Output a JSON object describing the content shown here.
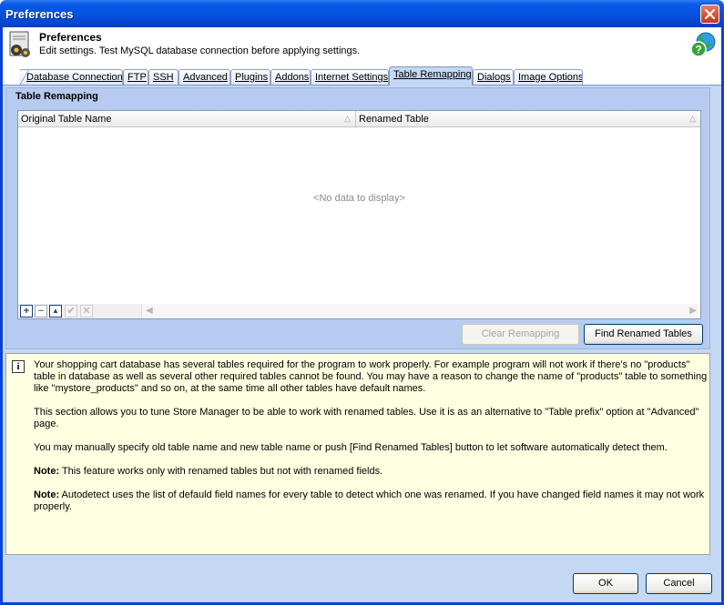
{
  "window": {
    "title": "Preferences",
    "close_icon": "close-icon"
  },
  "header": {
    "title": "Preferences",
    "subtitle": "Edit settings. Test MySQL database connection before applying settings.",
    "icon": "settings-gears-icon",
    "help_icon": "help-globe-icon"
  },
  "tabs": [
    {
      "label": "Database Connection",
      "active": false
    },
    {
      "label": "FTP",
      "active": false
    },
    {
      "label": "SSH",
      "active": false
    },
    {
      "label": "Advanced",
      "active": false
    },
    {
      "label": "Plugins",
      "active": false
    },
    {
      "label": "Addons",
      "active": false
    },
    {
      "label": "Internet Settings",
      "active": false
    },
    {
      "label": "Table Remapping",
      "active": true
    },
    {
      "label": "Dialogs",
      "active": false
    },
    {
      "label": "Image Options",
      "active": false
    }
  ],
  "group": {
    "title": "Table Remapping"
  },
  "grid": {
    "columns": [
      "Original Table Name",
      "Renamed Table"
    ],
    "rows": [],
    "empty_text": "<No data to display>",
    "navigator": {
      "add": "+",
      "remove": "−",
      "up": "▲",
      "accept": "✔",
      "cancel": "✕"
    },
    "scroll_left": "◀",
    "scroll_right": "▶"
  },
  "buttons": {
    "clear_remapping": "Clear Remapping",
    "find_renamed_tables": "Find Renamed Tables",
    "ok": "OK",
    "cancel": "Cancel"
  },
  "info": {
    "icon": "info-icon",
    "icon_glyph": "i",
    "p1": "Your shopping cart database has several tables required for the program to work properly. For example program will not work if there's no \"products\" table in database as well as several other required tables cannot be found. You may have a reason to change the name of \"products\" table to something like \"mystore_products\" and so on, at the same time all other tables have default names.",
    "p2": "This section allows you to tune Store Manager to be able to work with renamed tables. Use it is as an alternative to \"Table prefix\" option at \"Advanced\" page.",
    "p3": "You may manually specify old table name and new table name or push [Find Renamed Tables] button to let software automatically detect them.",
    "note1_label": "Note:",
    "note1_text": " This feature works only with renamed tables but not with renamed fields.",
    "note2_label": "Note:",
    "note2_text": " Autodetect uses the list of defauld field names for every table to detect which one was renamed. If you have changed field names it may not work properly."
  },
  "colors": {
    "titlebar": "#0553e0",
    "client": "#c4d8f3",
    "info_background": "#ffffe1"
  }
}
